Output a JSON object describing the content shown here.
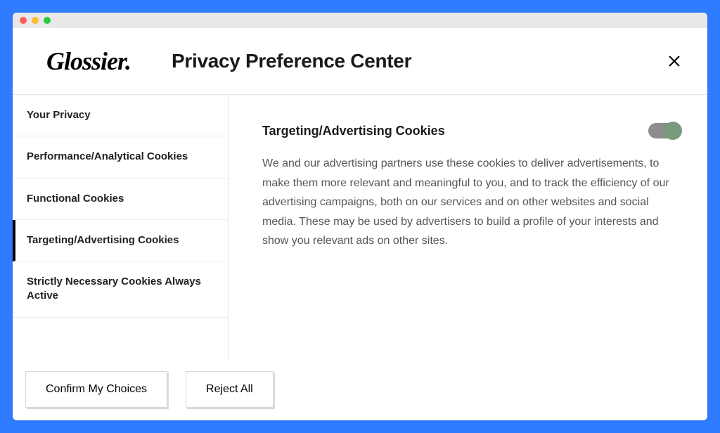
{
  "brand": "Glossier.",
  "header": {
    "title": "Privacy Preference Center"
  },
  "sidebar": {
    "items": [
      {
        "label": "Your Privacy"
      },
      {
        "label": "Performance/Analytical Cookies"
      },
      {
        "label": "Functional Cookies"
      },
      {
        "label": "Targeting/Advertising Cookies"
      },
      {
        "label": "Strictly Necessary Cookies Always Active"
      }
    ],
    "activeIndex": 3
  },
  "content": {
    "title": "Targeting/Advertising Cookies",
    "description": "We and our advertising partners use these cookies to deliver advertisements, to make them more relevant and meaningful to you, and to track the efficiency of our advertising campaigns, both on our services and on other websites and social media. These may be used by advertisers to build a profile of your interests and show you relevant ads on other sites.",
    "toggleOn": true
  },
  "footer": {
    "confirm_label": "Confirm My Choices",
    "reject_label": "Reject All"
  }
}
